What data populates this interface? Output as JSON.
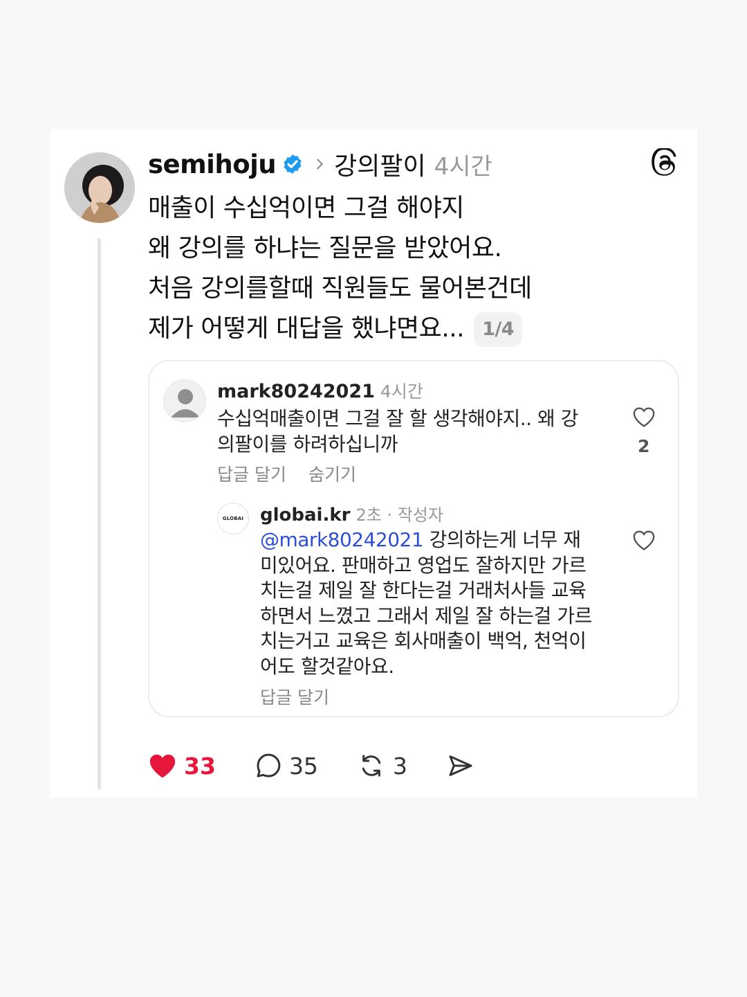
{
  "post": {
    "username": "semihoju",
    "topic": "강의팔이",
    "time": "4시간",
    "lines": [
      "매출이 수십억이면 그걸 해야지",
      "왜 강의를 하냐는 질문을 받았어요.",
      "처음 강의를할때 직원들도 물어본건데",
      "제가 어떻게 대답을 했냐면요..."
    ],
    "page_indicator": "1/4"
  },
  "comment": {
    "username": "mark80242021",
    "time": "4시간",
    "text_line1": "수십억매출이면 그걸 잘 할 생각해야지.. 왜 강",
    "text_line2": "의팔이를 하려하십니까",
    "reply_label": "답글 달기",
    "hide_label": "숨기기",
    "like_count": "2"
  },
  "reply": {
    "avatar_text": "GLOBAI",
    "username": "globai.kr",
    "meta": "2초 · 작성자",
    "mention": "@mark80242021",
    "lines": [
      " 강의하는게 너무 재",
      "미있어요. 판매하고 영업도 잘하지만 가르",
      "치는걸 제일 잘 한다는걸 거래처사들 교육",
      "하면서 느꼈고 그래서 제일 잘 하는걸 가르",
      "치는거고 교육은 회사매출이 백억, 천억이",
      "어도 할것같아요."
    ],
    "reply_label": "답글 달기"
  },
  "actions": {
    "likes": "33",
    "comments": "35",
    "reposts": "3"
  },
  "colors": {
    "like_red": "#e6173a",
    "mention_blue": "#2c4fd6",
    "verified_blue": "#1d9bf0"
  }
}
